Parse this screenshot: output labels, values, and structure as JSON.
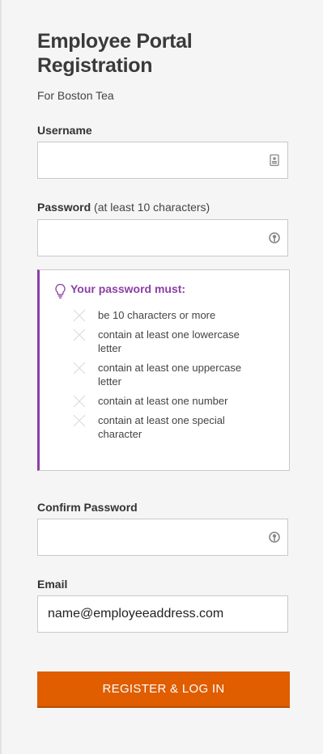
{
  "form": {
    "title": "Employee Portal Registration",
    "subtitle": "For Boston Tea",
    "username_label": "Username",
    "username_value": "",
    "password_label": "Password",
    "password_hint": "(at least 10 characters)",
    "password_value": "",
    "rules_title": "Your password must:",
    "rules": [
      "be 10 characters or more",
      "contain at least one lowercase letter",
      "contain at least one uppercase letter",
      "contain at least one number",
      "contain at least one special character"
    ],
    "confirm_label": "Confirm Password",
    "confirm_value": "",
    "email_label": "Email",
    "email_value": "name@employeeaddress.com",
    "submit_label": "REGISTER & LOG IN"
  },
  "icons": {
    "username_field": "contact-card-icon",
    "password_field": "key-icon",
    "rules_title": "lightbulb-icon",
    "rule_status": "x-icon"
  },
  "colors": {
    "accent_purple": "#8b3fa6",
    "button_orange": "#e05d00"
  }
}
